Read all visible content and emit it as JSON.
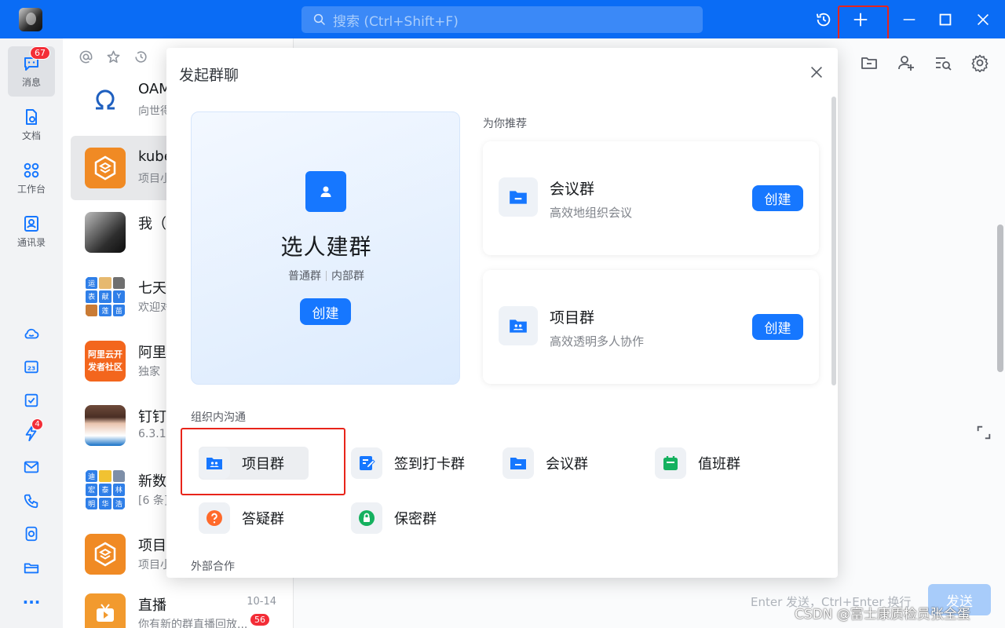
{
  "topbar": {
    "search_placeholder": "搜索 (Ctrl+Shift+F)"
  },
  "rail": {
    "items": [
      {
        "label": "消息",
        "icon": "message-icon",
        "badge": "67"
      },
      {
        "label": "文档",
        "icon": "document-icon"
      },
      {
        "label": "工作台",
        "icon": "workbench-icon"
      },
      {
        "label": "通讯录",
        "icon": "contacts-icon"
      }
    ],
    "small_icons": [
      "cloud-icon",
      "calendar-icon",
      "todo-icon",
      "ding-icon",
      "mail-icon",
      "phone-icon",
      "document-copy-icon",
      "folder-icon",
      "more-icon"
    ],
    "calendar_day": "23",
    "ding_badge": "4",
    "more_label": "···"
  },
  "conversations": [
    {
      "title": "OAM",
      "sub": "向世得",
      "avatar": "omega"
    },
    {
      "title": "kube",
      "sub": "项目小",
      "avatar": "hex-orange"
    },
    {
      "title": "我（",
      "sub": "",
      "avatar": "photo-man"
    },
    {
      "title": "七天",
      "sub": "欢迎对",
      "avatar": "grid-1",
      "grid": [
        "运",
        "",
        "",
        "表",
        "献",
        "Y",
        "",
        "莲",
        "苗"
      ]
    },
    {
      "title": "阿里",
      "sub": "独家",
      "avatar": "aliyun",
      "avatar_text": "阿里云开发者社区"
    },
    {
      "title": "钉钉",
      "sub": "6.3.1",
      "avatar": "photo-woman"
    },
    {
      "title": "新数",
      "sub": "[6 条]",
      "avatar": "grid-2",
      "grid": [
        "迪",
        "",
        "",
        "宏",
        "泰",
        "林",
        "明",
        "华",
        "浩"
      ]
    },
    {
      "title": "项目",
      "sub": "项目小",
      "avatar": "hex-orange"
    },
    {
      "title": "直播",
      "sub": "你有新的群直播回放...",
      "avatar": "live",
      "time": "10-14",
      "badge": "56"
    }
  ],
  "chat": {
    "footer_hint": "Enter 发送，Ctrl+Enter 换行",
    "send_label": "发送",
    "watermark": "CSDN @富士康质检员张全蛋"
  },
  "modal": {
    "title": "发起群聊",
    "big_card": {
      "title": "选人建群",
      "sub_a": "普通群",
      "sub_b": "内部群",
      "button": "创建"
    },
    "recommend_label": "为你推荐",
    "recommend": [
      {
        "title": "会议群",
        "desc": "高效地组织会议",
        "button": "创建",
        "icon": "folder-icon"
      },
      {
        "title": "项目群",
        "desc": "高效透明多人协作",
        "button": "创建",
        "icon": "project-folder-icon"
      }
    ],
    "internal_label": "组织内沟通",
    "internal_items": [
      {
        "label": "项目群",
        "icon": "project-folder-icon",
        "color": "#1677ff"
      },
      {
        "label": "签到打卡群",
        "icon": "checkin-icon",
        "color": "#1677ff"
      },
      {
        "label": "会议群",
        "icon": "folder-icon",
        "color": "#1677ff"
      },
      {
        "label": "值班群",
        "icon": "duty-calendar-icon",
        "color": "#15b15f"
      },
      {
        "label": "答疑群",
        "icon": "question-icon",
        "color": "#ff6a2b"
      },
      {
        "label": "保密群",
        "icon": "lock-icon",
        "color": "#15b15f"
      }
    ],
    "external_label": "外部合作"
  },
  "colors": {
    "brand": "#0a6cf5",
    "primary": "#1677ff",
    "highlight_box": "#e8241a",
    "badge": "#f32d37"
  }
}
